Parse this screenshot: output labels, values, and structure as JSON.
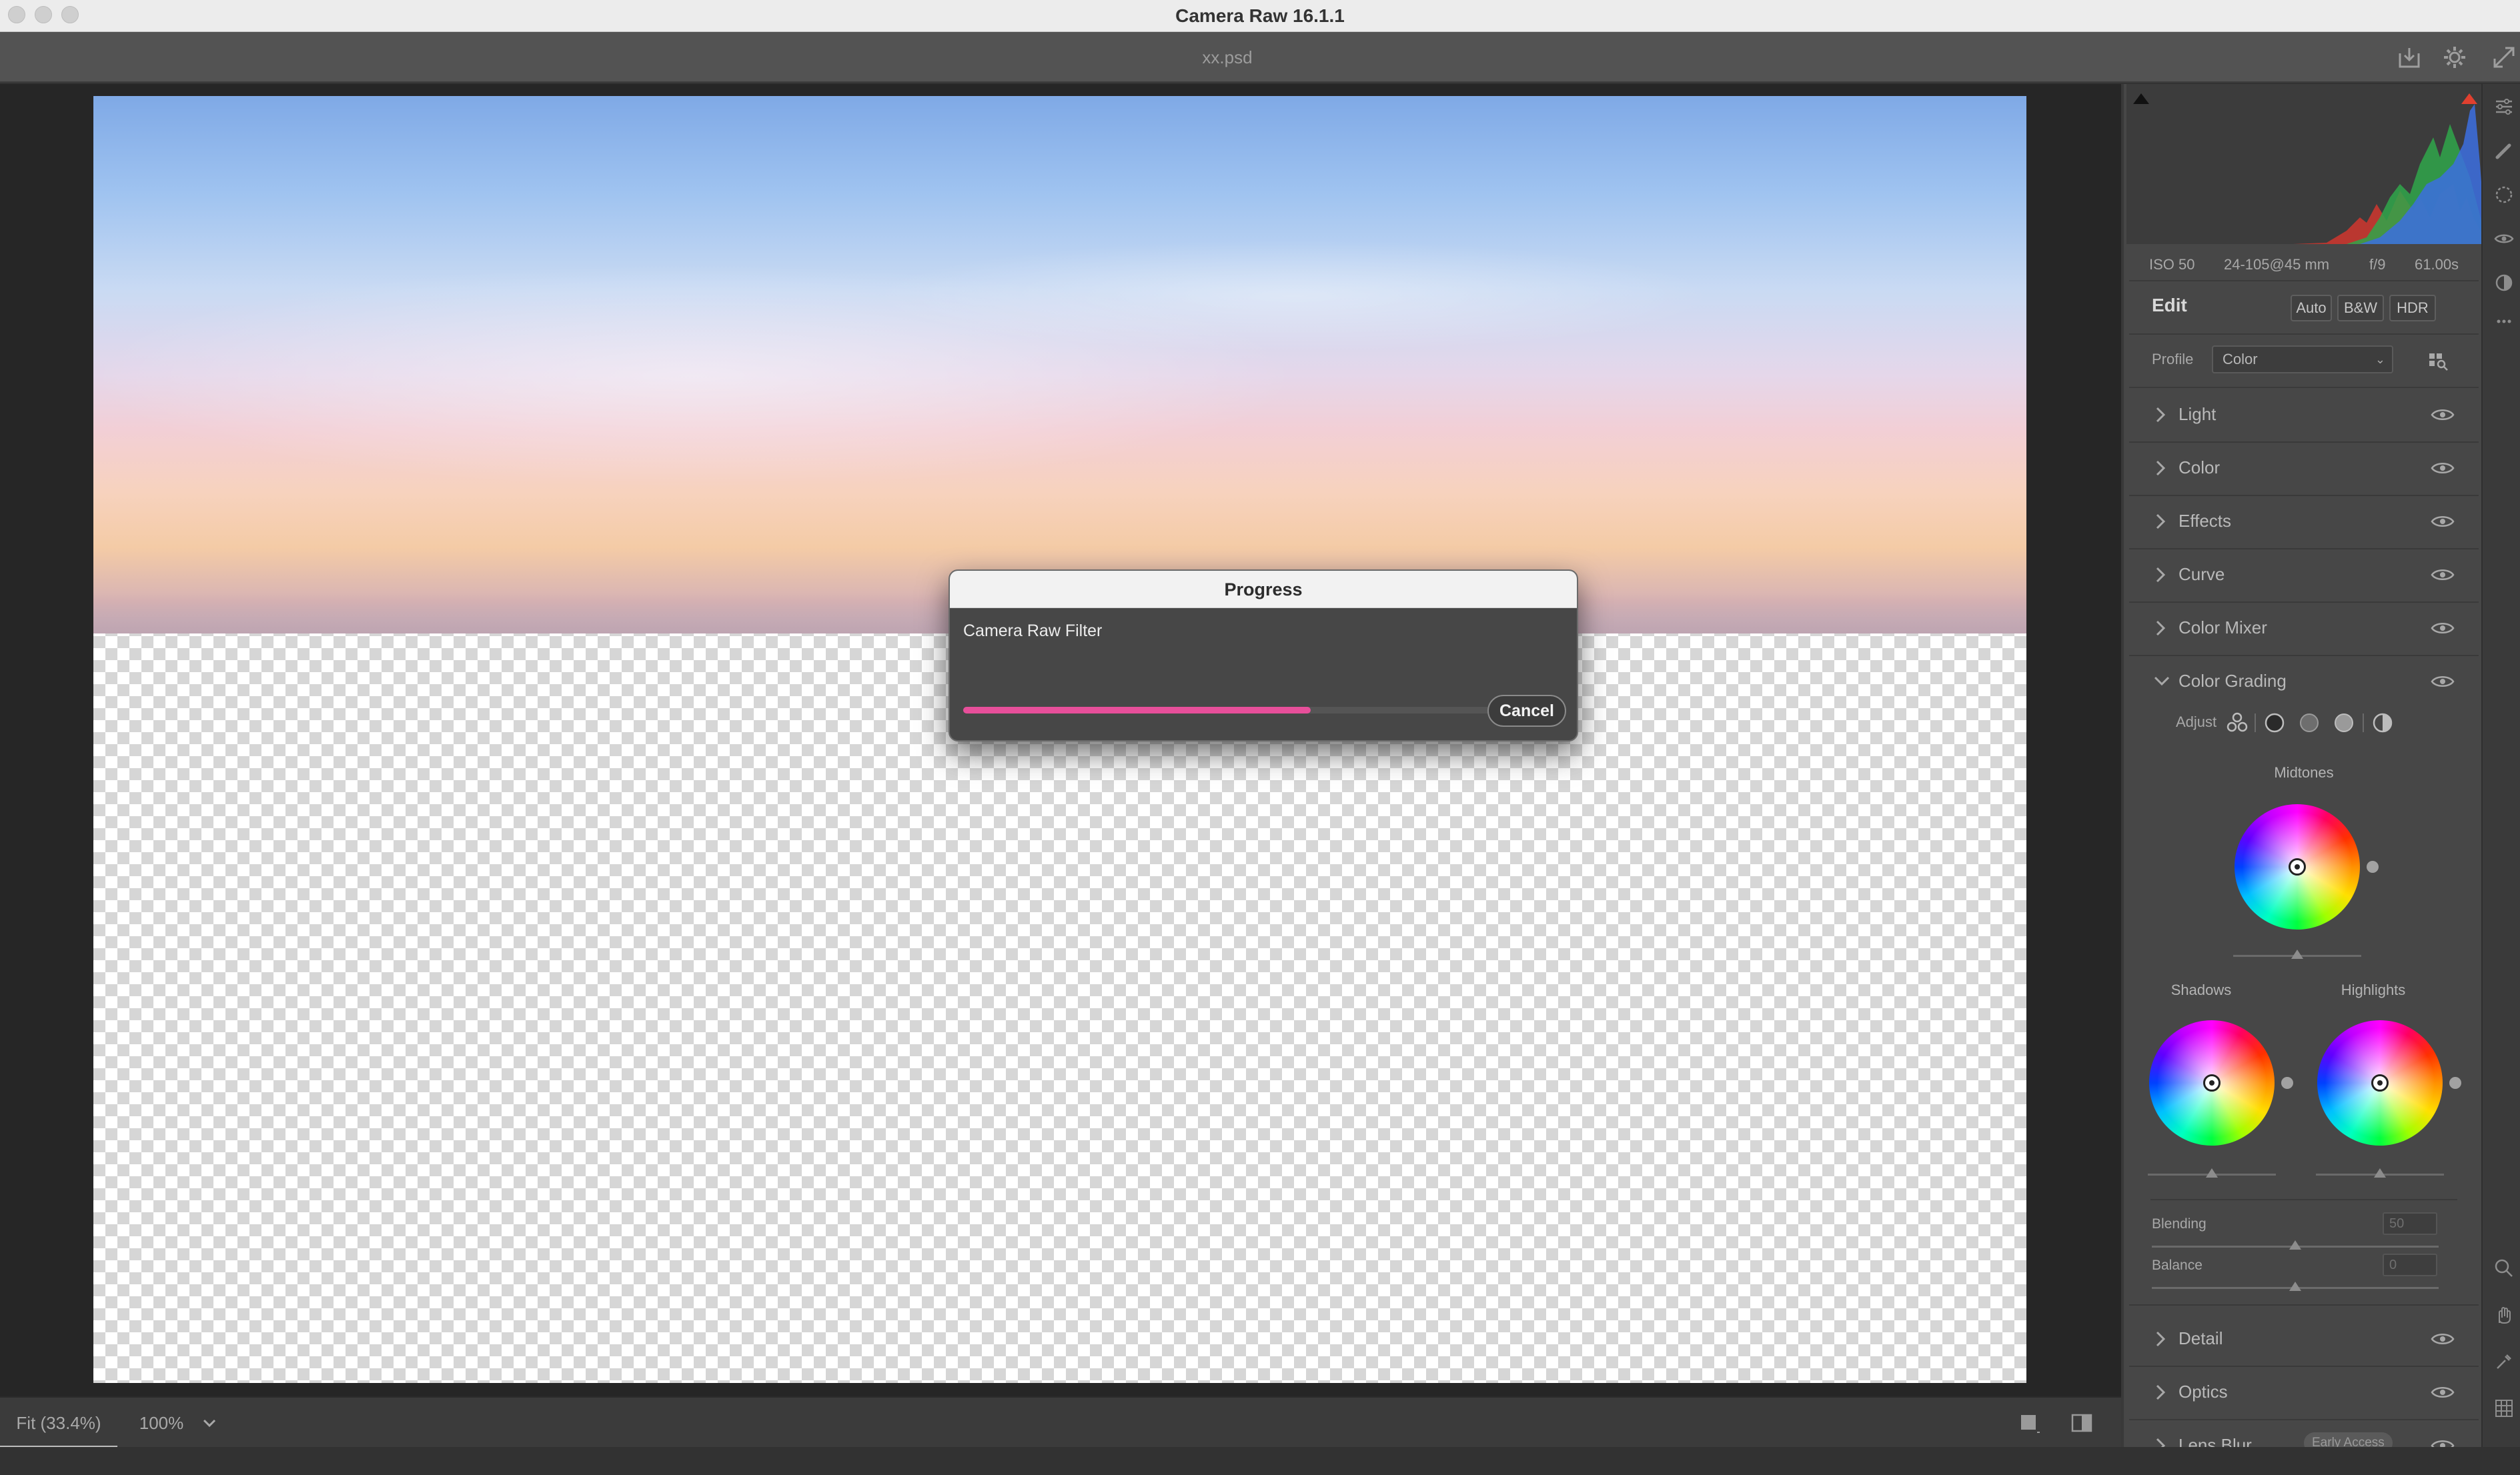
{
  "window": {
    "title": "Camera Raw 16.1.1"
  },
  "document": {
    "title": "xx.psd"
  },
  "histogram": {
    "exif": {
      "iso": "ISO 50",
      "lens": "24-105@45 mm",
      "aperture": "f/9",
      "shutter": "61.00s"
    }
  },
  "edit": {
    "title": "Edit",
    "buttons": [
      "Auto",
      "B&W",
      "HDR"
    ],
    "profile": {
      "label": "Profile",
      "value": "Color"
    },
    "sections": {
      "light": "Light",
      "color": "Color",
      "effects": "Effects",
      "curve": "Curve",
      "color_mixer": "Color Mixer",
      "color_grading": "Color Grading",
      "detail": "Detail",
      "optics": "Optics",
      "lens_blur": "Lens Blur",
      "lens_blur_badge": "Early Access"
    }
  },
  "color_grading": {
    "adjust_label": "Adjust",
    "midtones_label": "Midtones",
    "shadows_label": "Shadows",
    "highlights_label": "Highlights",
    "blending": {
      "label": "Blending",
      "value": "50"
    },
    "balance": {
      "label": "Balance",
      "value": "0"
    }
  },
  "status": {
    "fit": "Fit (33.4%)",
    "zoom": "100%"
  },
  "dialog": {
    "title": "Progress",
    "message": "Camera Raw Filter",
    "progress": 0.66,
    "cancel_label": "Cancel",
    "accent_color": "#e74f9a"
  },
  "icons": {
    "save": "download-icon",
    "settings": "gear-icon",
    "fullscreen": "expand-icon"
  }
}
